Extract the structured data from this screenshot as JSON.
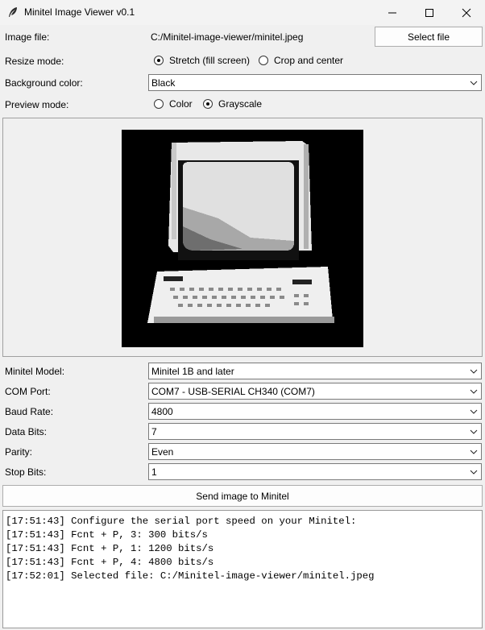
{
  "window": {
    "title": "Minitel Image Viewer v0.1",
    "icon": "feather-icon",
    "controls": [
      "minimize-icon",
      "maximize-icon",
      "close-icon"
    ]
  },
  "image_file": {
    "label": "Image file:",
    "path": "C:/Minitel-image-viewer/minitel.jpeg",
    "button": "Select file"
  },
  "resize_mode": {
    "label": "Resize mode:",
    "options": [
      "Stretch (fill screen)",
      "Crop and center"
    ],
    "selected": "Stretch (fill screen)"
  },
  "background_color": {
    "label": "Background color:",
    "value": "Black"
  },
  "preview_mode": {
    "label": "Preview mode:",
    "options": [
      "Color",
      "Grayscale"
    ],
    "selected": "Grayscale"
  },
  "settings": [
    {
      "label": "Minitel Model:",
      "value": "Minitel 1B and later"
    },
    {
      "label": "COM Port:",
      "value": "COM7 - USB-SERIAL CH340 (COM7)"
    },
    {
      "label": "Baud Rate:",
      "value": "4800"
    },
    {
      "label": "Data Bits:",
      "value": "7"
    },
    {
      "label": "Parity:",
      "value": "Even"
    },
    {
      "label": "Stop Bits:",
      "value": "1"
    }
  ],
  "send_button": "Send image to Minitel",
  "log": [
    "[17:51:43] Configure the serial port speed on your Minitel:",
    "[17:51:43] Fcnt + P, 3: 300 bits/s",
    "[17:51:43] Fcnt + P, 1: 1200 bits/s",
    "[17:51:43] Fcnt + P, 4: 4800 bits/s",
    "[17:52:01] Selected file: C:/Minitel-image-viewer/minitel.jpeg"
  ]
}
